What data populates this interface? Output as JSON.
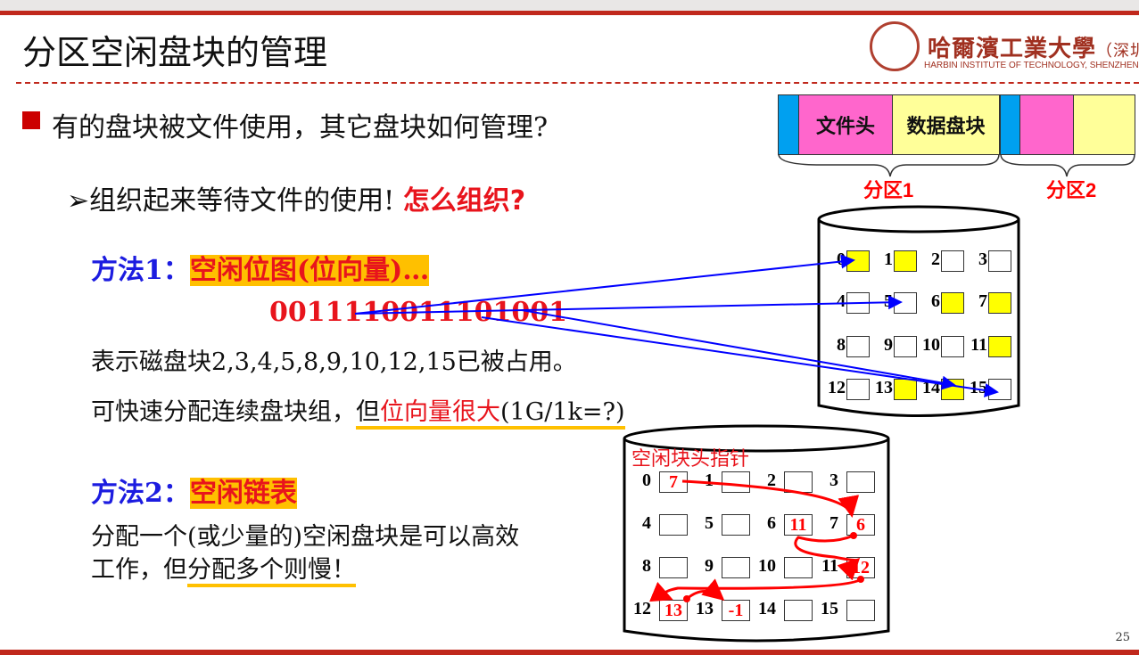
{
  "title": "分区空闲盘块的管理",
  "logo": {
    "cn": "哈爾濱工業大學",
    "cn_suffix": "（深圳",
    "en": "HARBIN INSTITUTE OF TECHNOLOGY, SHENZHEN",
    "seal": "HIT 1920"
  },
  "bullet1": "有的盘块被文件使用，其它盘块如何管理?",
  "sub1": "组织起来等待文件的使用!",
  "sub1_red": "怎么组织?",
  "method1_label": "方法1：",
  "method1_name": "空闲位图(位向量)…",
  "bitmap": "0011110011101001",
  "method1_desc": "表示磁盘块2,3,4,5,8,9,10,12,15已被占用。",
  "method1_note_a": "可快速分配连续盘块组，",
  "method1_note_b": "但",
  "method1_note_c": "位向量很大",
  "method1_note_d": "(1G/1k=?)",
  "method2_label": "方法2：",
  "method2_name": "空闲链表",
  "method2_desc1": "分配一个(或少量的)空闲盘块是可以高效",
  "method2_desc2a": "工作，但",
  "method2_desc2b": "分配多个则慢！",
  "partition": {
    "file_header": "文件头",
    "data_blocks": "数据盘块",
    "p1": "分区1",
    "p2": "分区2"
  },
  "bitmap_disk": {
    "blocks": [
      "0",
      "1",
      "2",
      "3",
      "4",
      "5",
      "6",
      "7",
      "8",
      "9",
      "10",
      "11",
      "12",
      "13",
      "14",
      "15"
    ],
    "free": [
      true,
      true,
      false,
      false,
      false,
      false,
      true,
      true,
      false,
      false,
      false,
      true,
      false,
      true,
      true,
      false
    ]
  },
  "list_disk": {
    "head_label": "空闲块头指针",
    "blocks": [
      "0",
      "1",
      "2",
      "3",
      "4",
      "5",
      "6",
      "7",
      "8",
      "9",
      "10",
      "11",
      "12",
      "13",
      "14",
      "15"
    ],
    "values": [
      "7",
      "",
      "",
      "",
      "",
      "",
      "11",
      "6",
      "",
      "",
      "",
      "12",
      "13",
      "-1",
      "",
      ""
    ]
  },
  "colors": {
    "accent": "#c0281c",
    "highlight": "#ffc000",
    "free": "#ffff00"
  },
  "page_number": "25"
}
